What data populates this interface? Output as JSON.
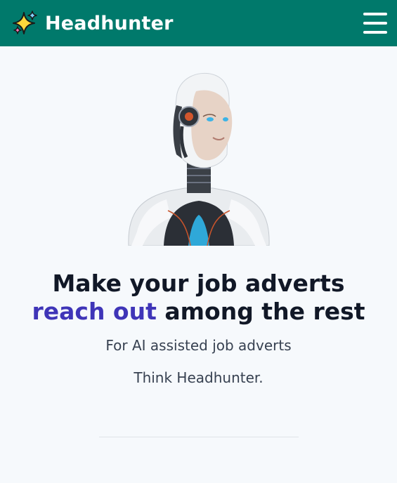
{
  "navbar": {
    "brand_name": "Headhunter",
    "brand_icon": "sparkles-icon",
    "menu_icon": "hamburger-menu-icon",
    "background_color": "#00796b"
  },
  "hero": {
    "image": "humanoid-robot-illustration",
    "headline_line1": "Make your job adverts",
    "headline_accent": "reach out",
    "headline_rest": " among the rest",
    "accent_color": "#3f35b8",
    "subtitle": "For AI assisted job adverts",
    "tagline": "Think Headhunter."
  }
}
